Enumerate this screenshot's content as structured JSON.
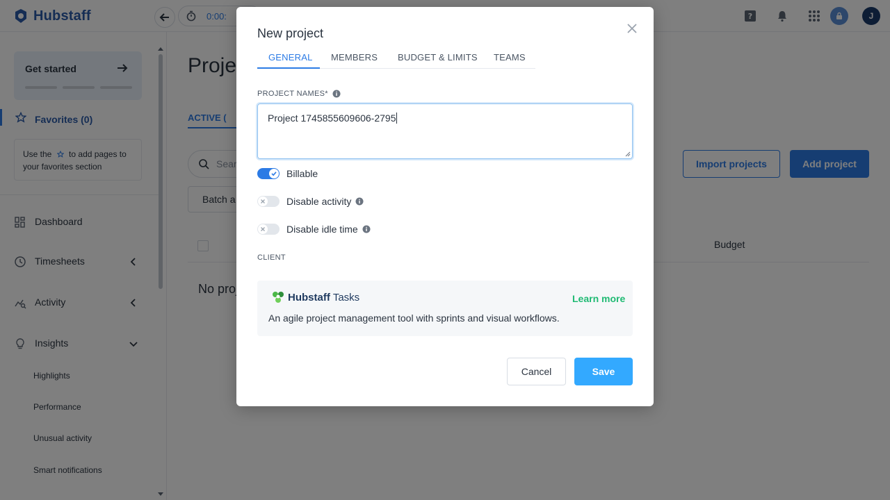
{
  "app": {
    "brand": "Hubstaff",
    "timer_text": "0:00:",
    "avatar_initial": "J"
  },
  "sidebar": {
    "get_started": "Get started",
    "favorites": "Favorites (0)",
    "favorites_hint_before": "Use the",
    "favorites_hint_after": "to add pages to your favorites section",
    "items": [
      {
        "label": "Dashboard",
        "icon": "dashboard-icon"
      },
      {
        "label": "Timesheets",
        "icon": "clock-icon"
      },
      {
        "label": "Activity",
        "icon": "activity-icon"
      },
      {
        "label": "Insights",
        "icon": "lightbulb-icon"
      }
    ],
    "insights_subitems": [
      "Highlights",
      "Performance",
      "Unusual activity",
      "Smart notifications"
    ]
  },
  "main": {
    "title": "Projec",
    "tab_active": "ACTIVE (",
    "search_placeholder": "Searc",
    "batch_label": "Batch a",
    "import_button": "Import projects",
    "add_button": "Add project",
    "column_budget": "Budget",
    "empty_text": "No proj"
  },
  "modal": {
    "title": "New project",
    "tabs": [
      "GENERAL",
      "MEMBERS",
      "BUDGET & LIMITS",
      "TEAMS"
    ],
    "active_tab": "GENERAL",
    "project_names_label": "PROJECT NAMES*",
    "project_name_value": "Project 1745855609606-2795",
    "toggles": [
      {
        "label": "Billable",
        "on": true,
        "info": false
      },
      {
        "label": "Disable activity",
        "on": false,
        "info": true
      },
      {
        "label": "Disable idle time",
        "on": false,
        "info": true
      }
    ],
    "client_label": "CLIENT",
    "tasks_card": {
      "brand": "Hubstaff",
      "product": "Tasks",
      "learn_more": "Learn more",
      "description": "An agile project management tool with sprints and visual workflows."
    },
    "cancel": "Cancel",
    "save": "Save"
  },
  "colors": {
    "accent": "#2c7be5",
    "save": "#33a9ff",
    "learn_more": "#1fba73",
    "overlay": "rgba(0,0,0,0.5)"
  }
}
